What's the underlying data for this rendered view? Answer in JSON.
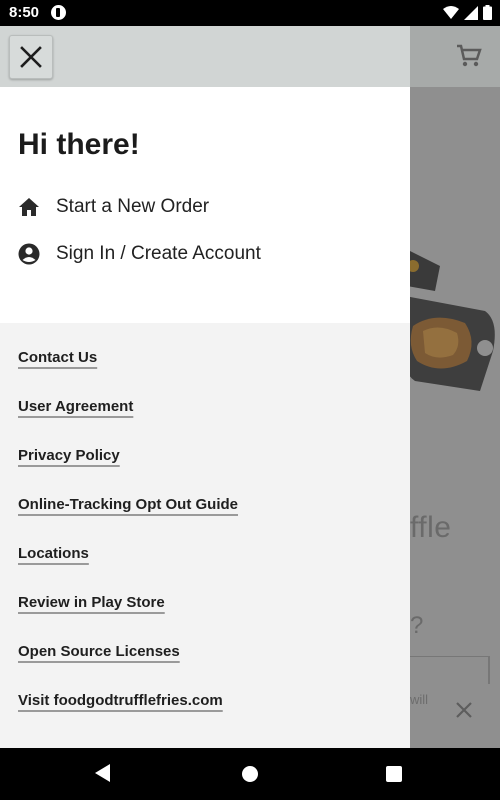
{
  "status_bar": {
    "time": "8:50",
    "icons": [
      "app-notification-icon",
      "wifi-icon",
      "signal-icon",
      "battery-icon"
    ]
  },
  "background_screen": {
    "heading_fragment": "ffle",
    "question_fragment": "?",
    "note_fragment": "will",
    "icons": [
      "cart-icon",
      "food-image",
      "close-icon"
    ]
  },
  "drawer": {
    "close_icon": "close-icon",
    "greeting": "Hi there!",
    "menu": [
      {
        "label": "Start a New Order",
        "icon": "home-icon"
      },
      {
        "label": "Sign In / Create Account",
        "icon": "account-circle-icon"
      }
    ],
    "links": [
      "Contact Us",
      "User Agreement",
      "Privacy Policy",
      "Online-Tracking Opt Out Guide",
      "Locations",
      "Review in Play Store",
      "Open Source Licenses",
      "Visit foodgodtrufflefries.com"
    ]
  },
  "nav_bar": {
    "icons": [
      "back-icon",
      "home-icon",
      "recents-icon"
    ]
  },
  "colors": {
    "drawer_background": "#f3f3f3",
    "drawer_header": "#d1d5d4",
    "drawer_top": "#ffffff",
    "scrim": "#8f8f8f",
    "text": "#1b1b1b"
  }
}
